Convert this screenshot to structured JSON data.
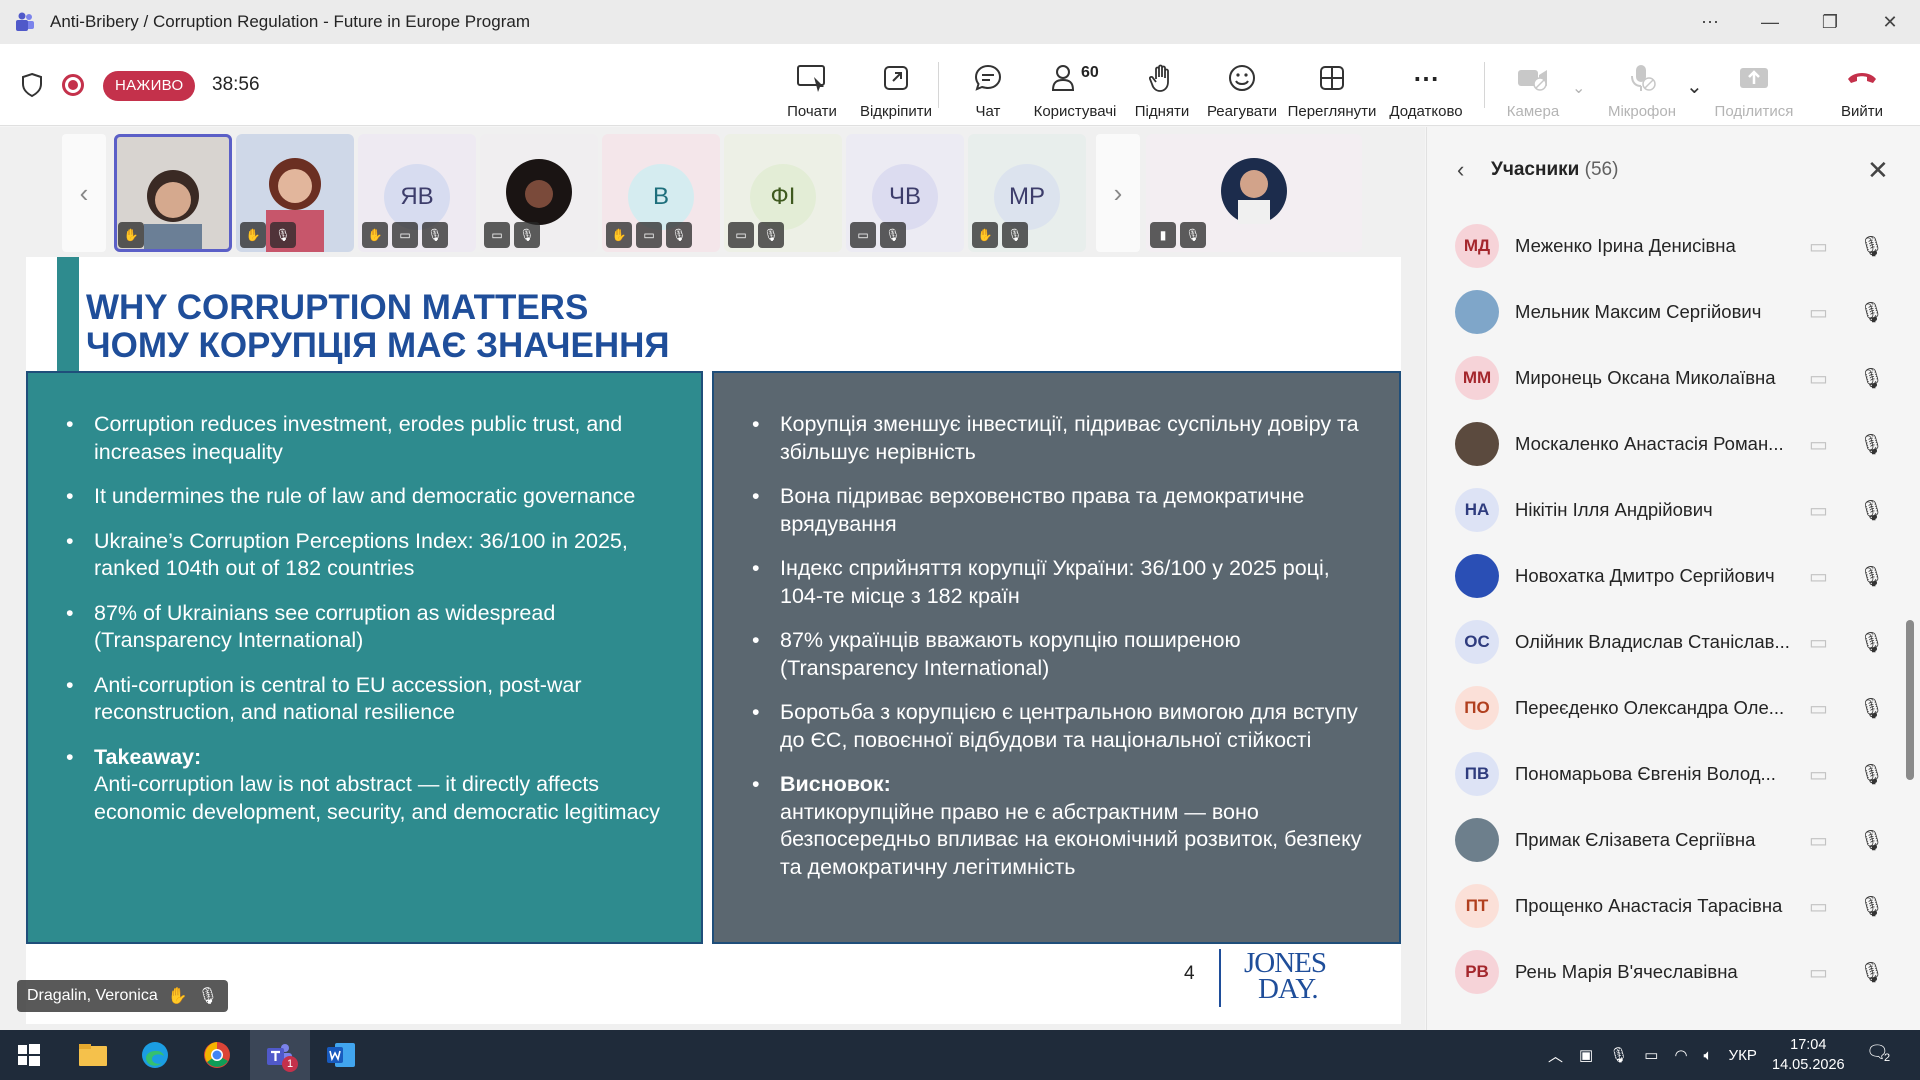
{
  "window": {
    "title": "Anti-Bribery / Corruption Regulation - Future in Europe Program"
  },
  "meeting": {
    "live_label": "НАЖИВО",
    "elapsed": "38:56",
    "toolbar": {
      "start": "Почати",
      "unpin": "Відкріпити",
      "chat": "Чат",
      "users": "Користувачі",
      "users_count": "60",
      "raise": "Підняти",
      "react": "Реагувати",
      "view": "Переглянути",
      "more": "Додатково",
      "camera": "Камера",
      "mic": "Мікрофон",
      "share": "Поділитися",
      "leave": "Вийти"
    },
    "thumbnails": [
      {
        "initials": ""
      },
      {
        "initials": ""
      },
      {
        "initials": "ЯВ"
      },
      {
        "initials": ""
      },
      {
        "initials": "В"
      },
      {
        "initials": "ФІ"
      },
      {
        "initials": "ЧВ"
      },
      {
        "initials": "МР"
      },
      {
        "initials": ""
      }
    ],
    "speaker_name": "Dragalin, Veronica"
  },
  "slide": {
    "title_en": "WHY CORRUPTION MATTERS",
    "title_uk": "ЧОМУ КОРУПЦІЯ МАЄ ЗНАЧЕННЯ",
    "left": {
      "bullets": [
        "Corruption reduces investment, erodes public trust, and increases inequality",
        "It undermines the rule of law and democratic governance",
        "Ukraine’s Corruption Perceptions Index: 36/100 in 2025, ranked 104th out of 182 countries",
        "87% of Ukrainians see corruption as widespread (Transparency International)",
        "Anti-corruption is central to EU accession, post-war reconstruction, and national resilience"
      ],
      "takeaway_label": "Takeaway:",
      "takeaway_text": "Anti-corruption law is not abstract — it directly affects economic development, security, and democratic legitimacy"
    },
    "right": {
      "bullets": [
        "Корупція зменшує інвестиції, підриває суспільну довіру та збільшує нерівність",
        "Вона підриває верховенство права та демократичне врядування",
        "Індекс сприйняття корупції України: 36/100 у 2025 році, 104-те місце з 182 країн",
        "87% українців вважають корупцію поширеною (Transparency International)",
        "Боротьба з корупцією є центральною вимогою для вступу до ЄС, повоєнної відбудови та національної стійкості"
      ],
      "takeaway_label": "Висновок:",
      "takeaway_text": "антикорупційне право не є абстрактним — воно безпосередньо впливає на економічний розвиток, безпеку та демократичну легітимність"
    },
    "page_number": "4",
    "logo_line1": "JONES",
    "logo_line2": "DAY."
  },
  "participants": {
    "title": "Учасники",
    "count": "(56)",
    "list": [
      {
        "initials": "МД",
        "name": "Меженко Ірина Денисівна",
        "color": "#f6d3d8",
        "text_color": "#a4262c"
      },
      {
        "initials": "",
        "name": "Мельник Максим Сергійович",
        "color": "#7fa6c9",
        "text_color": "#ffffff"
      },
      {
        "initials": "ММ",
        "name": "Миронець Оксана Миколаївна",
        "color": "#f6d3d8",
        "text_color": "#a4262c"
      },
      {
        "initials": "",
        "name": "Москаленко Анастасія Роман...",
        "color": "#5b4a3e",
        "text_color": "#ffffff"
      },
      {
        "initials": "НА",
        "name": "Нікітін Ілля Андрійович",
        "color": "#dde3f5",
        "text_color": "#2f3c7e"
      },
      {
        "initials": "",
        "name": "Новохатка Дмитро Сергійович",
        "color": "#2a4fb5",
        "text_color": "#ffffff"
      },
      {
        "initials": "ОС",
        "name": "Олійник Владислав Станіслав...",
        "color": "#dde3f5",
        "text_color": "#2f3c7e"
      },
      {
        "initials": "ПО",
        "name": "Переєденко Олександра Оле...",
        "color": "#fbe0d8",
        "text_color": "#b13f1e"
      },
      {
        "initials": "ПВ",
        "name": "Пономарьова Євгенія Волод...",
        "color": "#dde3f5",
        "text_color": "#2f3c7e"
      },
      {
        "initials": "",
        "name": "Примак Єлізавета Сергіївна",
        "color": "#6d7f8c",
        "text_color": "#ffffff"
      },
      {
        "initials": "ПТ",
        "name": "Прощенко Анастасія Тарасівна",
        "color": "#fbe0d8",
        "text_color": "#b13f1e"
      },
      {
        "initials": "РВ",
        "name": "Рень Марія В'ячеславівна",
        "color": "#f6d3d8",
        "text_color": "#a4262c"
      }
    ]
  },
  "taskbar": {
    "lang": "УКР",
    "time": "17:04",
    "date": "14.05.2026",
    "notif_count": "2",
    "teams_badge": "1"
  }
}
